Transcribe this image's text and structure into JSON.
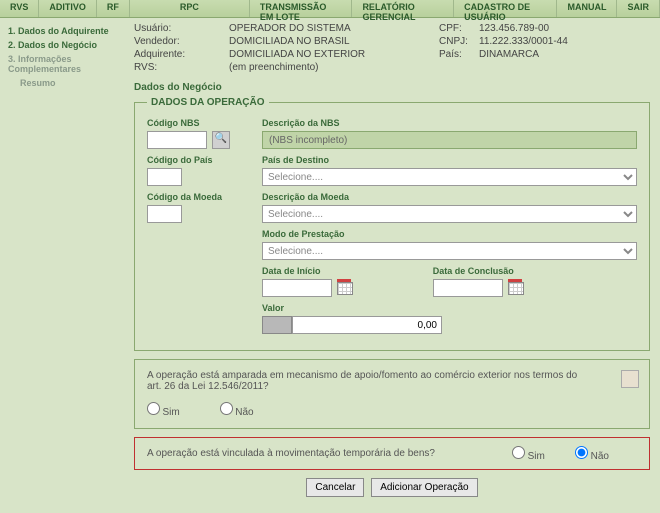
{
  "nav": {
    "rvs": "RVS",
    "aditivo": "ADITIVO",
    "rf": "RF",
    "rpc": "RPC",
    "transmissao": "TRANSMISSÃO EM LOTE",
    "relatorio": "RELATÓRIO GERENCIAL",
    "cadastro": "CADASTRO DE USUÁRIO",
    "manual": "MANUAL",
    "sair": "SAIR"
  },
  "sidebar": {
    "step1": "1. Dados do Adquirente",
    "step2": "2. Dados do Negócio",
    "step3": "3. Informações Complementares",
    "resumo": "Resumo"
  },
  "header": {
    "labels": {
      "usuario": "Usuário:",
      "vendedor": "Vendedor:",
      "adquirente": "Adquirente:",
      "rvs": "RVS:",
      "cpf": "CPF:",
      "cnpj": "CNPJ:",
      "pais": "País:"
    },
    "values": {
      "usuario": "OPERADOR DO SISTEMA",
      "vendedor": "DOMICILIADA NO BRASIL",
      "adquirente": "DOMICILIADA NO EXTERIOR",
      "rvs": "(em preenchimento)",
      "cpf": "123.456.789-00",
      "cnpj": "11.222.333/0001-44",
      "pais": "DINAMARCA"
    }
  },
  "section_title": "Dados do Negócio",
  "fieldset_legend": "DADOS DA OPERAÇÃO",
  "labels": {
    "codigo_nbs": "Código NBS",
    "descricao_nbs": "Descrição da NBS",
    "codigo_pais": "Código do País",
    "pais_destino": "País de Destino",
    "codigo_moeda": "Código da Moeda",
    "descricao_moeda": "Descrição da Moeda",
    "modo_prestacao": "Modo de Prestação",
    "data_inicio": "Data de Início",
    "data_conclusao": "Data de Conclusão",
    "valor": "Valor"
  },
  "values": {
    "nbs_desc": "(NBS incompleto)",
    "selecione": "Selecione....",
    "valor": "0,00"
  },
  "q1": {
    "text": "A operação está amparada em mecanismo de apoio/fomento ao comércio exterior nos termos do art. 26 da Lei 12.546/2011?",
    "sim": "Sim",
    "nao": "Não"
  },
  "q2": {
    "text": "A operação está vinculada à movimentação temporária de bens?",
    "sim": "Sim",
    "nao": "Não",
    "selected": "nao"
  },
  "buttons": {
    "cancelar": "Cancelar",
    "adicionar": "Adicionar Operação"
  }
}
